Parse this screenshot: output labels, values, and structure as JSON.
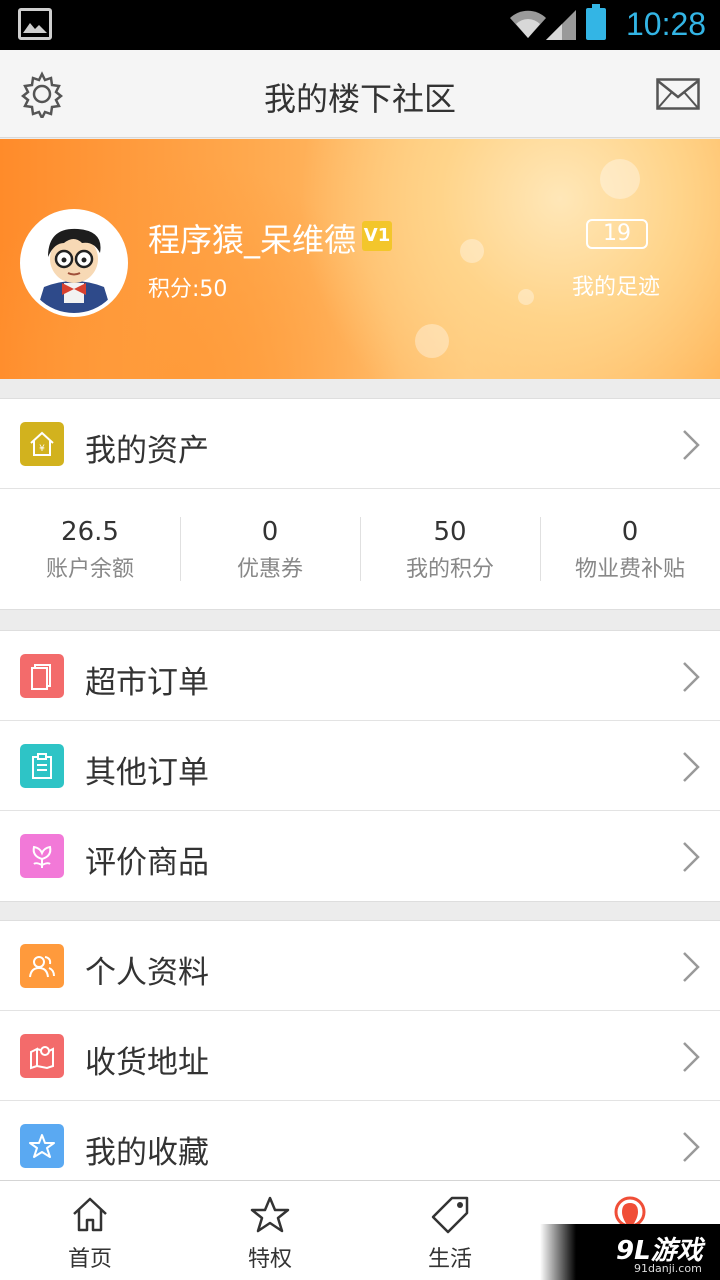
{
  "status_bar": {
    "time": "10:28"
  },
  "header": {
    "title": "我的楼下社区"
  },
  "profile": {
    "username": "程序猿_呆维德",
    "vip_badge": "V1",
    "points_text": "积分:50",
    "footprint_count": "19",
    "footprint_label": "我的足迹"
  },
  "assets": {
    "title": "我的资产",
    "stats": [
      {
        "value": "26.5",
        "label": "账户余额"
      },
      {
        "value": "0",
        "label": "优惠券"
      },
      {
        "value": "50",
        "label": "我的积分"
      },
      {
        "value": "0",
        "label": "物业费补贴"
      }
    ]
  },
  "orders": [
    {
      "label": "超市订单",
      "color": "#f36b6b"
    },
    {
      "label": "其他订单",
      "color": "#2ec4c6"
    },
    {
      "label": "评价商品",
      "color": "#f279d8"
    }
  ],
  "account": [
    {
      "label": "个人资料",
      "color": "#ff9a3c"
    },
    {
      "label": "收货地址",
      "color": "#f36b6b"
    },
    {
      "label": "我的收藏",
      "color": "#5aa9f2"
    }
  ],
  "tabbar": {
    "tabs": [
      "首页",
      "特权",
      "生活"
    ]
  },
  "watermark": {
    "main": "9L游戏",
    "sub": "91danji.com"
  },
  "colors": {
    "banner_orange": "#ff8b2a",
    "assets_icon": "#d2b21e",
    "accent_blue": "#33b5e5"
  }
}
